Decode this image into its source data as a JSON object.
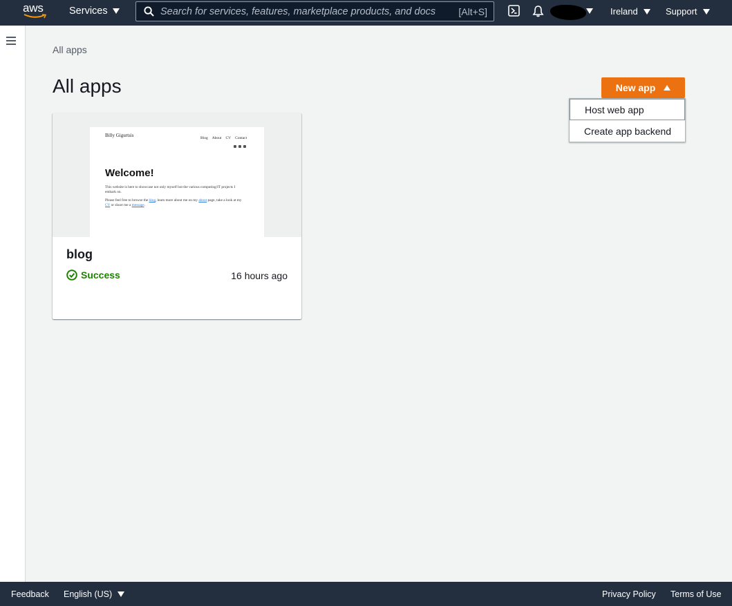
{
  "topnav": {
    "logo_text": "aws",
    "services_label": "Services",
    "search": {
      "placeholder": "Search for services, features, marketplace products, and docs",
      "shortcut": "[Alt+S]"
    },
    "region_label": "Ireland",
    "support_label": "Support"
  },
  "breadcrumb": {
    "items": [
      "All apps"
    ]
  },
  "page": {
    "title": "All apps",
    "new_app_label": "New app",
    "dropdown": {
      "items": [
        "Host web app",
        "Create app backend"
      ]
    }
  },
  "apps": [
    {
      "name": "blog",
      "status": "Success",
      "updated": "16 hours ago",
      "preview": {
        "site_name": "Billy Gigurtsis",
        "nav": [
          "Blog",
          "About",
          "CV",
          "Contact"
        ],
        "heading": "Welcome!",
        "p1": "This website is here to showcase not only myself but the various computing/IT projects I embark on.",
        "p2_a": "Please feel free to browse the ",
        "p2_blog": "blog",
        "p2_b": ", learn more about me on my ",
        "p2_about": "about",
        "p2_c": " page, take a look at my ",
        "p2_cv": "CV",
        "p2_d": " or shoot me a ",
        "p2_message": "message",
        "p2_e": "."
      }
    }
  ],
  "footer": {
    "feedback_label": "Feedback",
    "language_label": "English (US)",
    "privacy_label": "Privacy Policy",
    "terms_label": "Terms of Use"
  },
  "colors": {
    "nav_bg": "#232f3e",
    "primary_button": "#ec7211",
    "success": "#1d8102",
    "page_bg": "#f2f3f3"
  },
  "icons": [
    "aws-logo-icon",
    "search-icon",
    "cloudshell-icon",
    "bell-icon",
    "hamburger-icon",
    "success-check-icon"
  ]
}
